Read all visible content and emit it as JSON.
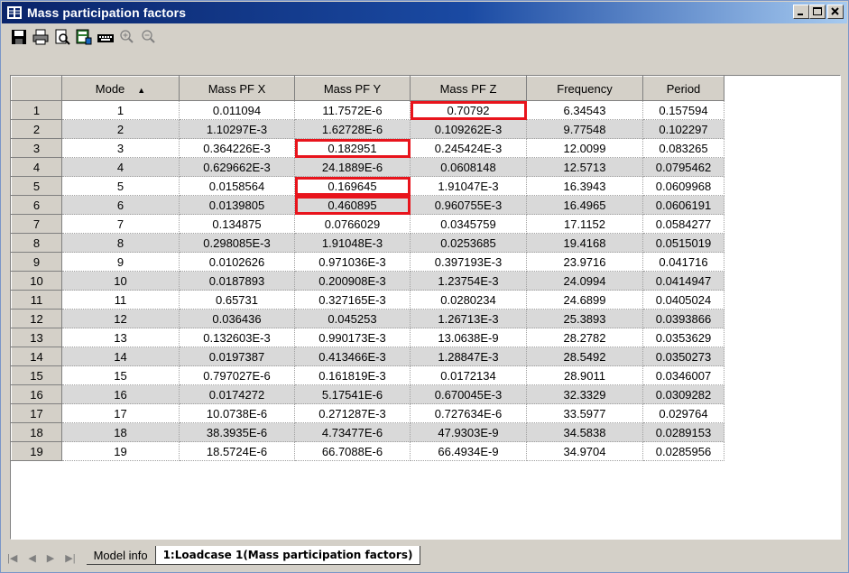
{
  "window": {
    "title": "Mass participation factors"
  },
  "toolbar": {
    "icons": [
      "save-icon",
      "print-icon",
      "print-preview-icon",
      "export-excel-icon",
      "keyboard-icon",
      "zoom-in-icon",
      "zoom-out-icon"
    ]
  },
  "table": {
    "columns": [
      "Mode",
      "Mass PF X",
      "Mass PF Y",
      "Mass PF Z",
      "Frequency",
      "Period"
    ],
    "sort_indicator": "▲",
    "rows": [
      {
        "n": "1",
        "cells": [
          "1",
          "0.011094",
          "11.7572E-6",
          "0.70792",
          "6.34543",
          "0.157594"
        ]
      },
      {
        "n": "2",
        "cells": [
          "2",
          "1.10297E-3",
          "1.62728E-6",
          "0.109262E-3",
          "9.77548",
          "0.102297"
        ]
      },
      {
        "n": "3",
        "cells": [
          "3",
          "0.364226E-3",
          "0.182951",
          "0.245424E-3",
          "12.0099",
          "0.083265"
        ]
      },
      {
        "n": "4",
        "cells": [
          "4",
          "0.629662E-3",
          "24.1889E-6",
          "0.0608148",
          "12.5713",
          "0.0795462"
        ]
      },
      {
        "n": "5",
        "cells": [
          "5",
          "0.0158564",
          "0.169645",
          "1.91047E-3",
          "16.3943",
          "0.0609968"
        ]
      },
      {
        "n": "6",
        "cells": [
          "6",
          "0.0139805",
          "0.460895",
          "0.960755E-3",
          "16.4965",
          "0.0606191"
        ]
      },
      {
        "n": "7",
        "cells": [
          "7",
          "0.134875",
          "0.0766029",
          "0.0345759",
          "17.1152",
          "0.0584277"
        ]
      },
      {
        "n": "8",
        "cells": [
          "8",
          "0.298085E-3",
          "1.91048E-3",
          "0.0253685",
          "19.4168",
          "0.0515019"
        ]
      },
      {
        "n": "9",
        "cells": [
          "9",
          "0.0102626",
          "0.971036E-3",
          "0.397193E-3",
          "23.9716",
          "0.041716"
        ]
      },
      {
        "n": "10",
        "cells": [
          "10",
          "0.0187893",
          "0.200908E-3",
          "1.23754E-3",
          "24.0994",
          "0.0414947"
        ]
      },
      {
        "n": "11",
        "cells": [
          "11",
          "0.65731",
          "0.327165E-3",
          "0.0280234",
          "24.6899",
          "0.0405024"
        ]
      },
      {
        "n": "12",
        "cells": [
          "12",
          "0.036436",
          "0.045253",
          "1.26713E-3",
          "25.3893",
          "0.0393866"
        ]
      },
      {
        "n": "13",
        "cells": [
          "13",
          "0.132603E-3",
          "0.990173E-3",
          "13.0638E-9",
          "28.2782",
          "0.0353629"
        ]
      },
      {
        "n": "14",
        "cells": [
          "14",
          "0.0197387",
          "0.413466E-3",
          "1.28847E-3",
          "28.5492",
          "0.0350273"
        ]
      },
      {
        "n": "15",
        "cells": [
          "15",
          "0.797027E-6",
          "0.161819E-3",
          "0.0172134",
          "28.9011",
          "0.0346007"
        ]
      },
      {
        "n": "16",
        "cells": [
          "16",
          "0.0174272",
          "5.17541E-6",
          "0.670045E-3",
          "32.3329",
          "0.0309282"
        ]
      },
      {
        "n": "17",
        "cells": [
          "17",
          "10.0738E-6",
          "0.271287E-3",
          "0.727634E-6",
          "33.5977",
          "0.029764"
        ]
      },
      {
        "n": "18",
        "cells": [
          "18",
          "38.3935E-6",
          "4.73477E-6",
          "47.9303E-9",
          "34.5838",
          "0.0289153"
        ]
      },
      {
        "n": "19",
        "cells": [
          "19",
          "18.5724E-6",
          "66.7088E-6",
          "66.4934E-9",
          "34.9704",
          "0.0285956"
        ]
      }
    ],
    "highlights": [
      {
        "row": 0,
        "col": 3
      },
      {
        "row": 2,
        "col": 2
      },
      {
        "row": 4,
        "col": 2
      },
      {
        "row": 5,
        "col": 2
      }
    ],
    "highlight_color": "#e8141c"
  },
  "tabs": {
    "nav": [
      "|◀",
      "◀",
      "▶",
      "▶|"
    ],
    "items": [
      {
        "label": "Model info",
        "active": false
      },
      {
        "label": "1:Loadcase 1(Mass participation factors)",
        "active": true
      }
    ]
  }
}
